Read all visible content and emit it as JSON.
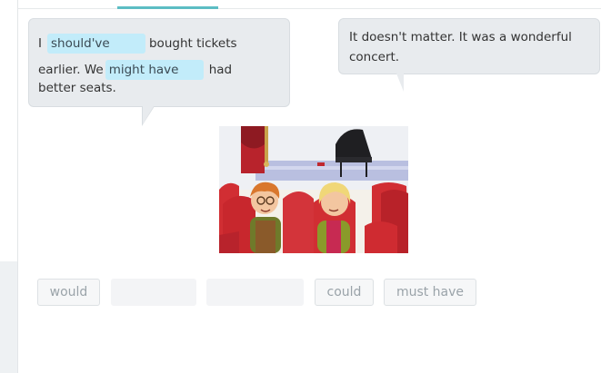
{
  "dialogue": {
    "left": {
      "before_blank_1": "I",
      "blank_1": "should've",
      "after_blank_1": "bought tickets",
      "before_blank_2": "earlier. We",
      "blank_2": "might have",
      "after_blank_2": "had",
      "line_3": "better seats."
    },
    "right": {
      "line_1": "It doesn't matter. It was a wonderful",
      "line_2": "concert."
    }
  },
  "word_bank": [
    "would",
    "",
    "",
    "could",
    "must have"
  ],
  "colors": {
    "accent": "#5cbdc4",
    "blank_fill": "#c2ecfa",
    "bubble_fill": "#e8ebee"
  }
}
